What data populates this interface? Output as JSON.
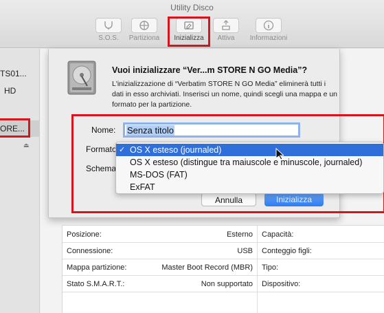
{
  "window": {
    "title": "Utility Disco"
  },
  "toolbar": {
    "items": [
      {
        "label": "S.O.S.",
        "icon": "stethoscope-icon"
      },
      {
        "label": "Partiziona",
        "icon": "partition-pie-icon"
      },
      {
        "label": "Inizializza",
        "icon": "erase-icon"
      },
      {
        "label": "Attiva",
        "icon": "mount-icon"
      },
      {
        "label": "Informazioni",
        "icon": "info-icon"
      }
    ]
  },
  "sidebar": {
    "items": [
      {
        "label": "TS01..."
      },
      {
        "label": "HD"
      },
      {
        "label": "ORE..."
      }
    ],
    "eject_glyph": "⏏"
  },
  "sheet": {
    "title": "Vuoi inizializzare “Ver...m STORE N GO Media”?",
    "description": "L'inizializzazione di “Verbatim STORE N GO Media” eliminerà tutti i dati in esso archiviati. Inserisci un nome, quindi scegli una mappa e un formato per la partizione.",
    "name_label": "Nome:",
    "name_value": "Senza titolo",
    "format_label": "Formato",
    "scheme_label": "Schema",
    "cancel_button": "Annulla",
    "erase_button": "Inizializza"
  },
  "format_menu": {
    "options": [
      {
        "label": "OS X esteso (journaled)",
        "selected": true
      },
      {
        "label": "OS X esteso (distingue tra maiuscole e minuscole, journaled)",
        "selected": false
      },
      {
        "label": "MS-DOS (FAT)",
        "selected": false
      },
      {
        "label": "ExFAT",
        "selected": false
      }
    ],
    "check_glyph": "✓"
  },
  "info": {
    "left": [
      {
        "key": "Posizione:",
        "value": "Esterno"
      },
      {
        "key": "Connessione:",
        "value": "USB"
      },
      {
        "key": "Mappa partizione:",
        "value": "Master Boot Record (MBR)"
      },
      {
        "key": "Stato S.M.A.R.T.:",
        "value": "Non supportato"
      }
    ],
    "right": [
      {
        "key": "Capacità:"
      },
      {
        "key": "Conteggio figli:"
      },
      {
        "key": "Tipo:"
      },
      {
        "key": "Dispositivo:"
      }
    ]
  },
  "colors": {
    "highlight": "#d4151b",
    "menu_selection": "#2f6fd9",
    "primary_button": "#2d7cf3"
  }
}
